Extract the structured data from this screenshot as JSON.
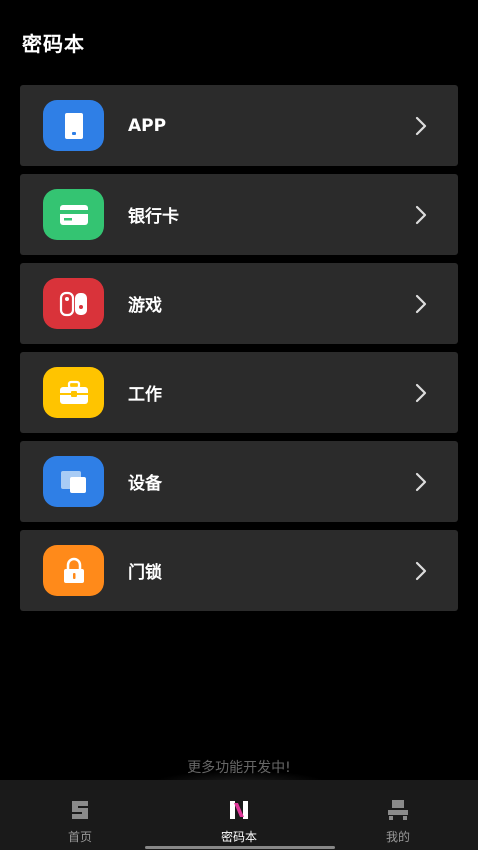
{
  "page_title": "密码本",
  "categories": [
    {
      "label": "APP",
      "icon": "tablet-icon",
      "color": "#2f7fe6"
    },
    {
      "label": "银行卡",
      "icon": "credit-card-icon",
      "color": "#34c472"
    },
    {
      "label": "游戏",
      "icon": "game-console-icon",
      "color": "#d9333a"
    },
    {
      "label": "工作",
      "icon": "briefcase-icon",
      "color": "#ffc400"
    },
    {
      "label": "设备",
      "icon": "devices-icon",
      "color": "#2f7fe6"
    },
    {
      "label": "门锁",
      "icon": "padlock-icon",
      "color": "#ff8a1a"
    }
  ],
  "notice": "更多功能开发中!",
  "tabs": [
    {
      "label": "首页",
      "icon": "home-s-icon",
      "active": false
    },
    {
      "label": "密码本",
      "icon": "password-book-icon",
      "active": true
    },
    {
      "label": "我的",
      "icon": "profile-icon",
      "active": false
    }
  ]
}
